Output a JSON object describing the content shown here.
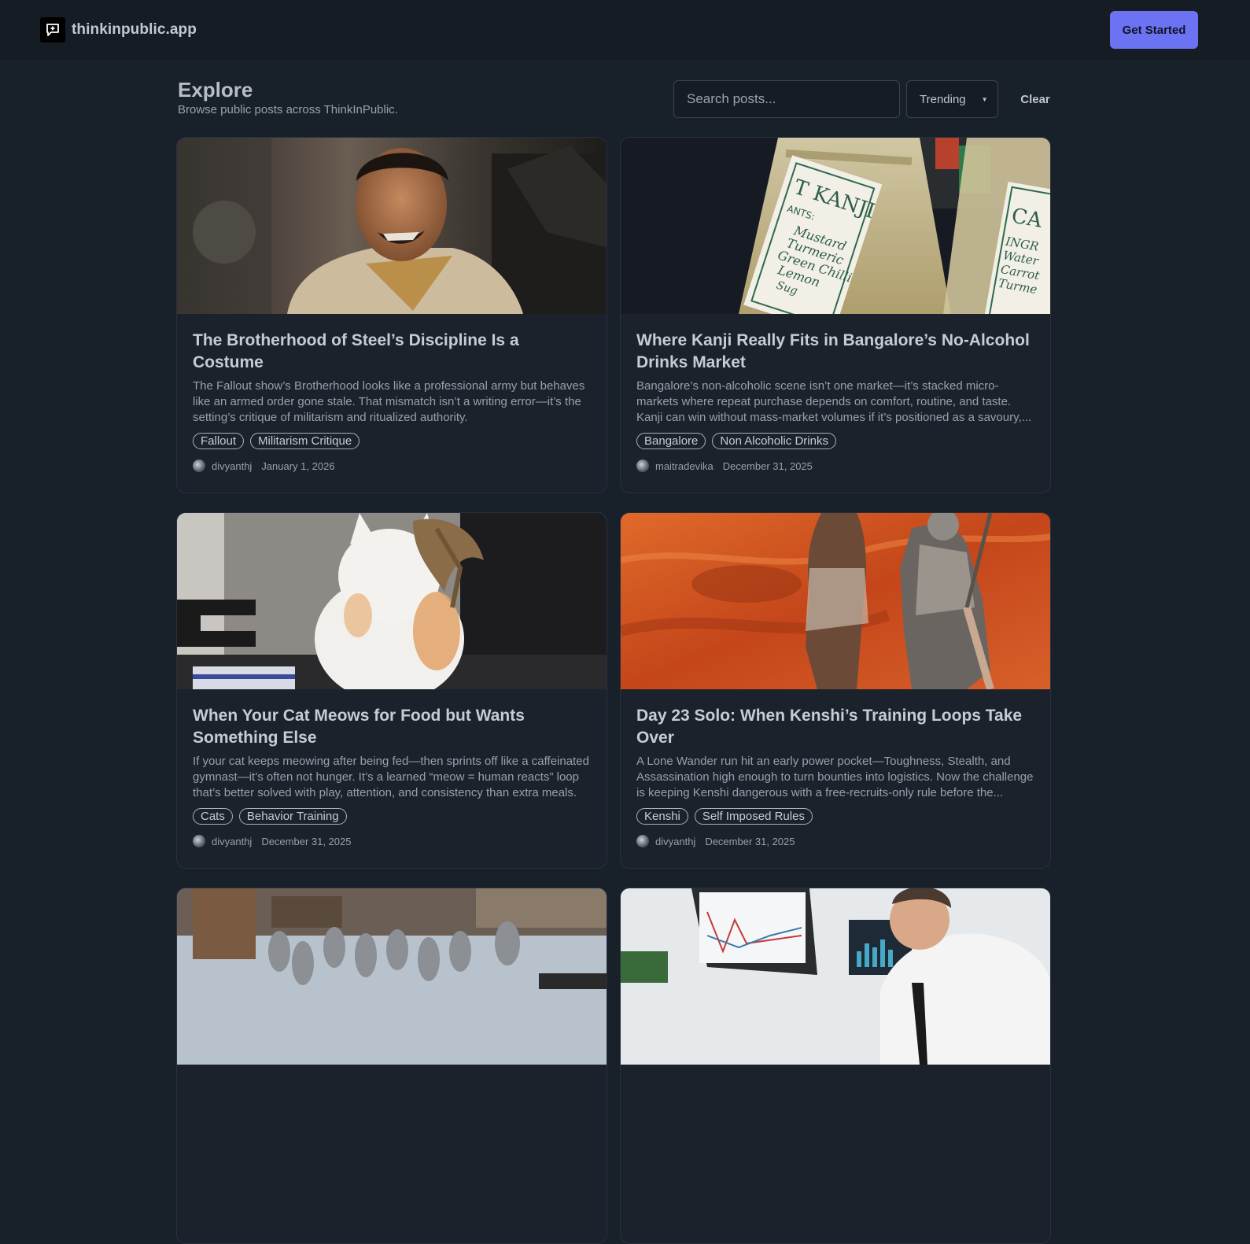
{
  "header": {
    "brand": "thinkinpublic.app",
    "cta_label": "Get Started",
    "logo_icon": "chat-plus-icon"
  },
  "explore": {
    "title": "Explore",
    "subtitle": "Browse public posts across ThinkInPublic.",
    "search_placeholder": "Search posts...",
    "sort_selected": "Trending",
    "clear_label": "Clear"
  },
  "posts": [
    {
      "title": "The Brotherhood of Steel’s Discipline Is a Costume",
      "excerpt": "The Fallout show’s Brotherhood looks like a professional army but behaves like an armed order gone stale. That mismatch isn’t a writing error—it’s the setting’s critique of militarism and ritualized authority.",
      "tags": [
        "Fallout",
        "Militarism Critique"
      ],
      "author": "divyanthj",
      "date": "January 1, 2026"
    },
    {
      "title": "Where Kanji Really Fits in Bangalore’s No-Alcohol Drinks Market",
      "excerpt": "Bangalore’s non-alcoholic scene isn’t one market—it’s stacked micro-markets where repeat purchase depends on comfort, routine, and taste. Kanji can win without mass-market volumes if it’s positioned as a savoury,...",
      "tags": [
        "Bangalore",
        "Non Alcoholic Drinks"
      ],
      "author": "maitradevika",
      "date": "December 31, 2025"
    },
    {
      "title": "When Your Cat Meows for Food but Wants Something Else",
      "excerpt": "If your cat keeps meowing after being fed—then sprints off like a caffeinated gymnast—it’s often not hunger. It’s a learned “meow = human reacts” loop that’s better solved with play, attention, and consistency than extra meals.",
      "tags": [
        "Cats",
        "Behavior Training"
      ],
      "author": "divyanthj",
      "date": "December 31, 2025"
    },
    {
      "title": "Day 23 Solo: When Kenshi’s Training Loops Take Over",
      "excerpt": "A Lone Wander run hit an early power pocket—Toughness, Stealth, and Assassination high enough to turn bounties into logistics. Now the challenge is keeping Kenshi dangerous with a free-recruits-only rule before the...",
      "tags": [
        "Kenshi",
        "Self Imposed Rules"
      ],
      "author": "divyanthj",
      "date": "December 31, 2025"
    },
    {
      "title": "",
      "excerpt": "",
      "tags": [],
      "author": "",
      "date": ""
    },
    {
      "title": "",
      "excerpt": "",
      "tags": [],
      "author": "",
      "date": ""
    }
  ],
  "bottle_labels": {
    "left": [
      "T KANJI",
      "ANTS:",
      "Mustard",
      "Turmeric",
      "Green Chilli",
      "Lemon",
      "Sug"
    ],
    "right": [
      "CA",
      "INGR",
      "Water",
      "Carrot",
      "Turme"
    ]
  }
}
